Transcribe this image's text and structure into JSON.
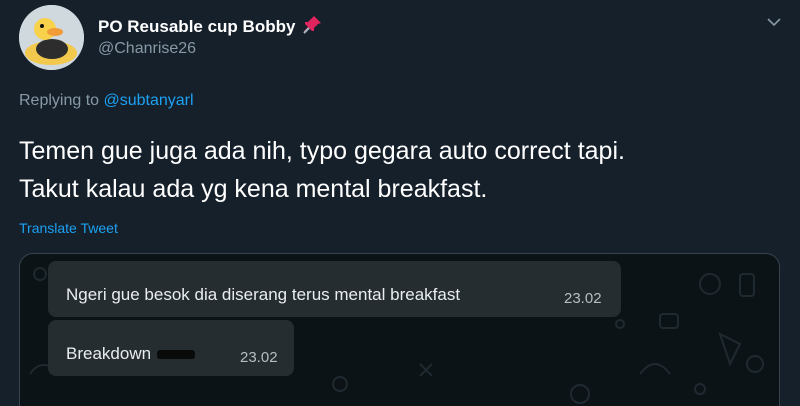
{
  "tweet": {
    "author_name": "PO Reusable cup Bobby",
    "author_emoji_icon": "pushpin-icon",
    "author_handle": "@Chanrise26",
    "replying_prefix": "Replying to",
    "replying_to": "@subtanyarl",
    "text_lines": [
      "Temen gue juga ada nih, typo gegara auto correct tapi.",
      "Takut kalau ada yg kena mental breakfast."
    ],
    "translate_label": "Translate Tweet"
  },
  "chat_image": {
    "messages": [
      {
        "text": "Ngeri gue besok dia diserang terus mental breakfast",
        "time": "23.02"
      },
      {
        "text": "Breakdown",
        "time": "23.02"
      }
    ]
  },
  "colors": {
    "background": "#15202b",
    "secondary_text": "#8899a6",
    "link": "#1da1f2",
    "chat_background": "#0c1317",
    "chat_bubble": "#262d31"
  }
}
